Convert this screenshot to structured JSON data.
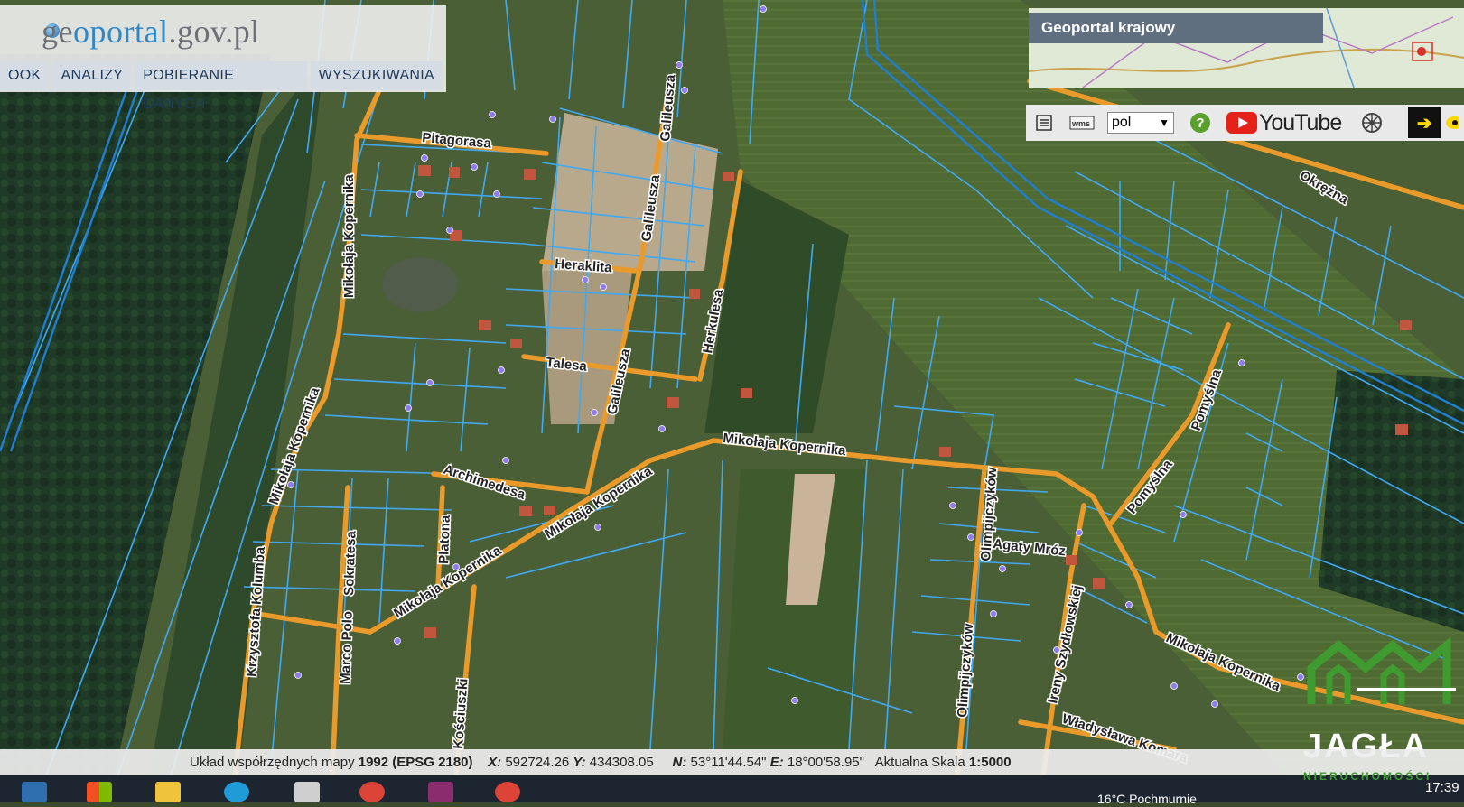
{
  "header": {
    "logo_prefix": "ge",
    "logo_accent": "oportal",
    "logo_suffix": ".gov.pl",
    "menu": [
      "OOK",
      "ANALIZY",
      "POBIERANIE DANYCH",
      "WYSZUKIWANIA"
    ]
  },
  "overview": {
    "title": "Geoportal krajowy"
  },
  "toolbar": {
    "language": "pol",
    "help_label": "?",
    "youtube_label": "YouTube",
    "icons": [
      "layers-icon",
      "wms-icon",
      "help-icon",
      "youtube-icon",
      "settings-icon",
      "arrow-icon",
      "eye-icon"
    ]
  },
  "streets": [
    "Pitagorasa",
    "Mikołaja Kopernika",
    "Galileusza",
    "Heraklita",
    "Herkulesa",
    "Talesa",
    "Archimedesa",
    "Krzysztofa Kolumba",
    "Marco Polo",
    "Sokratesa",
    "Platona",
    "Kościuszki",
    "Olimpijczyków",
    "Agaty Mróz",
    "Ireny Szydłowskiej",
    "Władysława Komara",
    "Pomyślna",
    "Okrężna"
  ],
  "status": {
    "coord_label": "Układ współrzędnych mapy",
    "coord_system": "1992 (EPSG 2180)",
    "x_label": "X:",
    "x_value": "592724.26",
    "y_label": "Y:",
    "y_value": "434308.05",
    "n_label": "N:",
    "n_value": "53°11'44.54\"",
    "e_label": "E:",
    "e_value": "18°00'58.95\"",
    "scale_label": "Aktualna Skala",
    "scale_value": "1:5000"
  },
  "taskbar": {
    "weather": "16°C  Pochmurnie",
    "time": "17:39"
  },
  "watermark": {
    "brand": "JAGŁA",
    "sub": "NIERUCHOMOŚCI"
  },
  "colors": {
    "parcel": "#3fa9f5",
    "road": "#e99a2a",
    "menu_text": "#1e3a5c",
    "watermark_green": "#3f9b2f"
  }
}
